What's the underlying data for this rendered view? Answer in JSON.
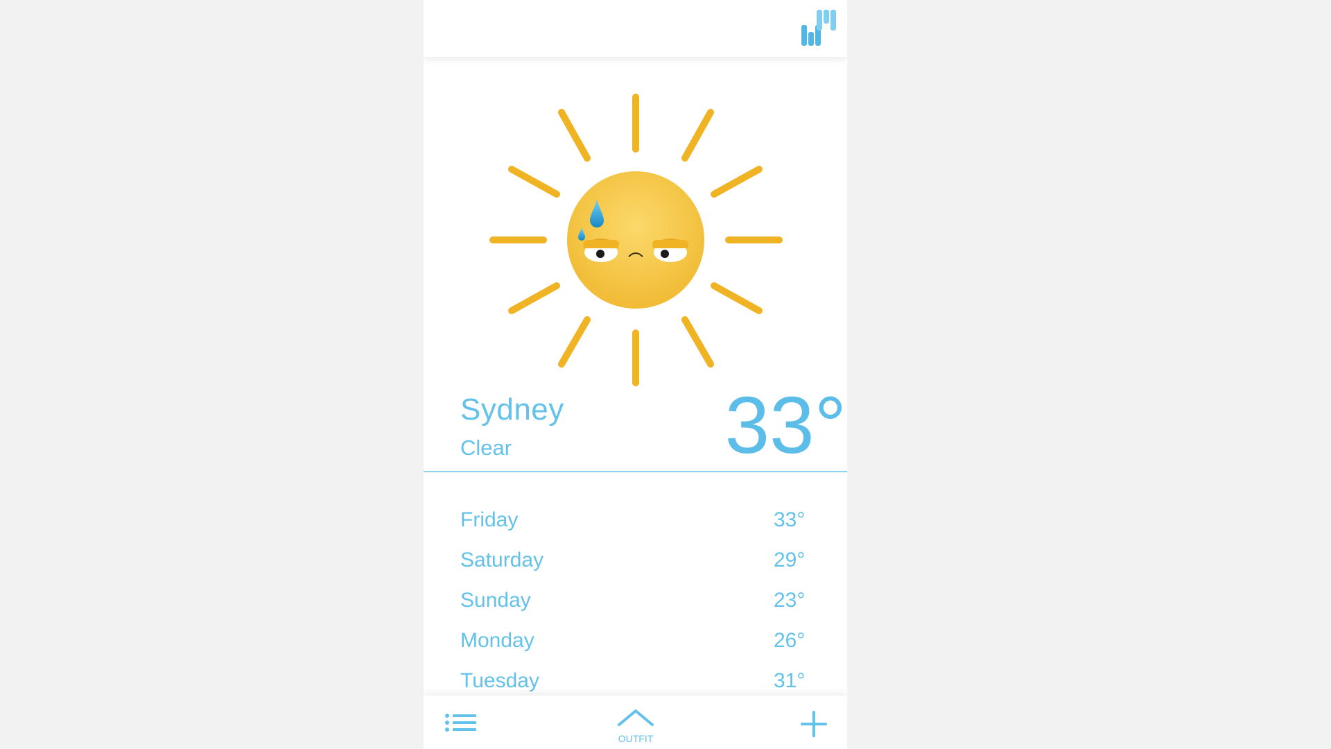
{
  "header": {
    "logo_icon": "wm-logo-icon"
  },
  "current": {
    "city": "Sydney",
    "condition": "Clear",
    "temperature": "33°",
    "illustration": "sweating-sun-icon"
  },
  "forecast": [
    {
      "day": "Friday",
      "high": "33°"
    },
    {
      "day": "Saturday",
      "high": "29°"
    },
    {
      "day": "Sunday",
      "high": "23°"
    },
    {
      "day": "Monday",
      "high": "26°"
    },
    {
      "day": "Tuesday",
      "high": "31°"
    }
  ],
  "bottom_bar": {
    "menu_icon": "list-icon",
    "outfit_label": "OUTFIT",
    "outfit_icon": "chevron-up-icon",
    "add_icon": "plus-icon"
  },
  "colors": {
    "accent": "#63c1ea",
    "sun_ray": "#f0b323",
    "sun_face": "#f6c94a",
    "background": "#f2f2f2"
  }
}
